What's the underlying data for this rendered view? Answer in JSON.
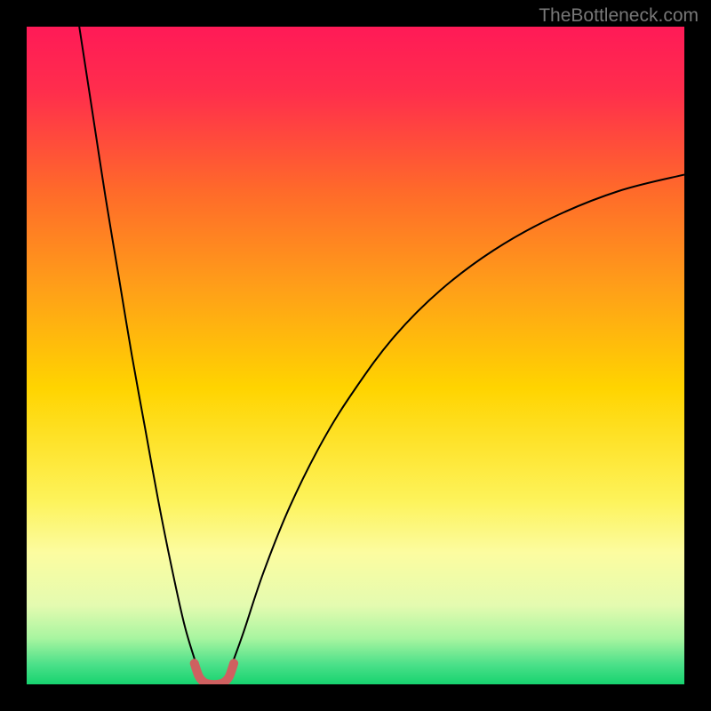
{
  "watermark": "TheBottleneck.com",
  "chart_data": {
    "type": "line",
    "title": "",
    "xlabel": "",
    "ylabel": "",
    "xlim": [
      0,
      100
    ],
    "ylim": [
      0,
      100
    ],
    "background_gradient": {
      "type": "vertical",
      "stops": [
        {
          "pos": 0.0,
          "color": "#ff1a57"
        },
        {
          "pos": 0.1,
          "color": "#ff2e4c"
        },
        {
          "pos": 0.25,
          "color": "#ff6a2a"
        },
        {
          "pos": 0.4,
          "color": "#ffa018"
        },
        {
          "pos": 0.55,
          "color": "#ffd400"
        },
        {
          "pos": 0.72,
          "color": "#fdf35a"
        },
        {
          "pos": 0.8,
          "color": "#fcfca0"
        },
        {
          "pos": 0.88,
          "color": "#e4fbb0"
        },
        {
          "pos": 0.93,
          "color": "#a8f5a0"
        },
        {
          "pos": 0.97,
          "color": "#4be089"
        },
        {
          "pos": 1.0,
          "color": "#17d36f"
        }
      ]
    },
    "series": [
      {
        "name": "curve-left",
        "stroke": "#000000",
        "stroke_width": 2,
        "x": [
          8.0,
          10.0,
          12.0,
          14.0,
          16.0,
          18.0,
          20.0,
          22.0,
          24.0,
          25.8
        ],
        "values": [
          100.0,
          87.0,
          74.0,
          62.0,
          50.0,
          39.0,
          28.0,
          18.0,
          9.0,
          3.0
        ]
      },
      {
        "name": "curve-right",
        "stroke": "#000000",
        "stroke_width": 2,
        "x": [
          31.2,
          33.0,
          36.0,
          40.0,
          45.0,
          50.0,
          56.0,
          63.0,
          71.0,
          80.0,
          90.0,
          100.0
        ],
        "values": [
          3.0,
          8.0,
          17.0,
          27.0,
          37.0,
          45.0,
          53.0,
          60.0,
          66.0,
          71.0,
          75.0,
          77.5
        ]
      },
      {
        "name": "valley-highlight",
        "stroke": "#cf6060",
        "stroke_width": 10,
        "linecap": "round",
        "x": [
          25.5,
          26.2,
          27.0,
          28.0,
          29.0,
          30.0,
          30.8,
          31.5
        ],
        "values": [
          3.2,
          1.2,
          0.3,
          0.0,
          0.0,
          0.3,
          1.2,
          3.2
        ]
      }
    ]
  }
}
